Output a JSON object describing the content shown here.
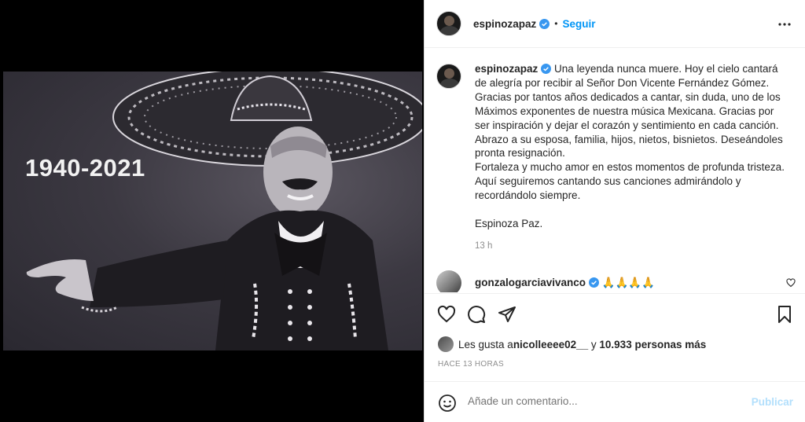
{
  "media": {
    "overlay_text": "1940-2021"
  },
  "header": {
    "username": "espinozapaz",
    "separator": "•",
    "follow_label": "Seguir"
  },
  "caption": {
    "username": "espinozapaz",
    "text": "Una leyenda nunca muere. Hoy el cielo cantará de alegría por recibir al Señor Don Vicente Fernández Gómez. Gracias por tantos años dedicados a cantar, sin duda, uno de los Máximos exponentes de nuestra música Mexicana. Gracias por ser inspiración y dejar el corazón y sentimiento en cada canción.\nAbrazo a su esposa, familia, hijos, nietos, bisnietos. Deseándoles pronta resignación.\nFortaleza y mucho amor en estos momentos de profunda tristeza. Aquí seguiremos cantando sus canciones admirándolo y recordándolo siempre.\n\nEspinoza Paz.",
    "time": "13 h"
  },
  "comment": {
    "username": "gonzalogarciavivanco",
    "text": "🙏🙏🙏🙏"
  },
  "likes": {
    "prefix": "Les gusta a ",
    "user": "nicolleeee02__",
    "middle": " y ",
    "count": "10.933 personas más"
  },
  "posted_ago": "HACE 13 HORAS",
  "add_comment": {
    "placeholder": "Añade un comentario...",
    "publish_label": "Publicar"
  },
  "colors": {
    "accent": "#0095f6",
    "publish_disabled": "#b2dffc",
    "verified": "#3897f0"
  }
}
